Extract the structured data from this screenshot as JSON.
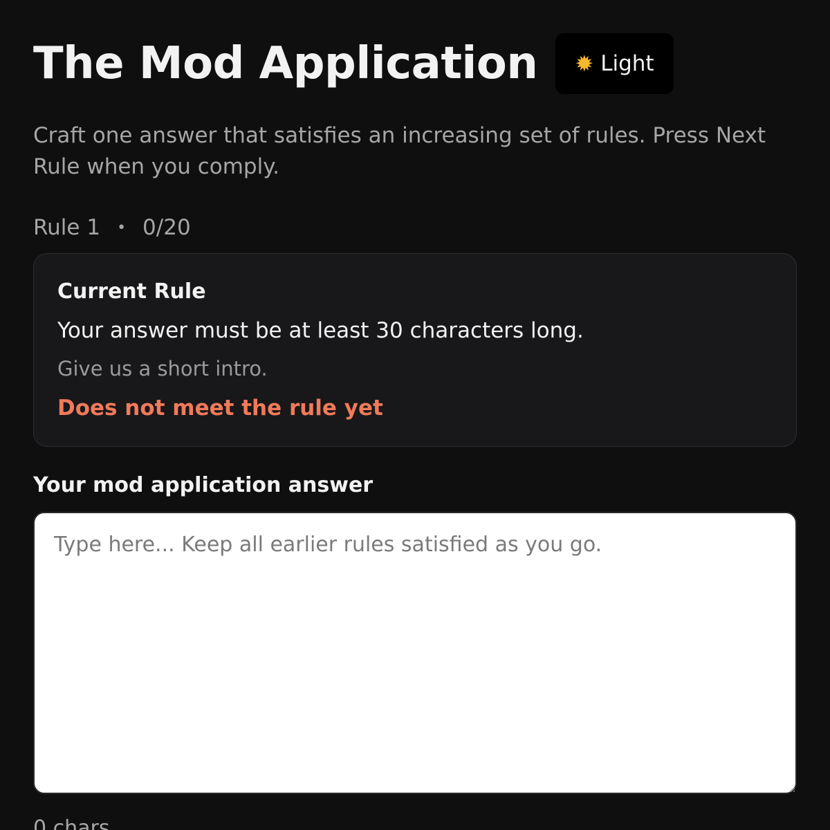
{
  "header": {
    "title": "The Mod Application",
    "theme_toggle": {
      "icon": "sun-icon",
      "glyph": "✹",
      "label": "Light"
    }
  },
  "subtitle": "Craft one answer that satisfies an increasing set of rules. Press Next Rule when you comply.",
  "progress": {
    "rule_label": "Rule 1",
    "separator": "•",
    "count": "0/20"
  },
  "rule_card": {
    "heading": "Current Rule",
    "text": "Your answer must be at least 30 characters long.",
    "hint": "Give us a short intro.",
    "status": "Does not meet the rule yet",
    "status_color": "#f07a5a"
  },
  "answer": {
    "label": "Your mod application answer",
    "value": "",
    "placeholder": "Type here... Keep all earlier rules satisfied as you go.",
    "char_count": "0 chars"
  }
}
